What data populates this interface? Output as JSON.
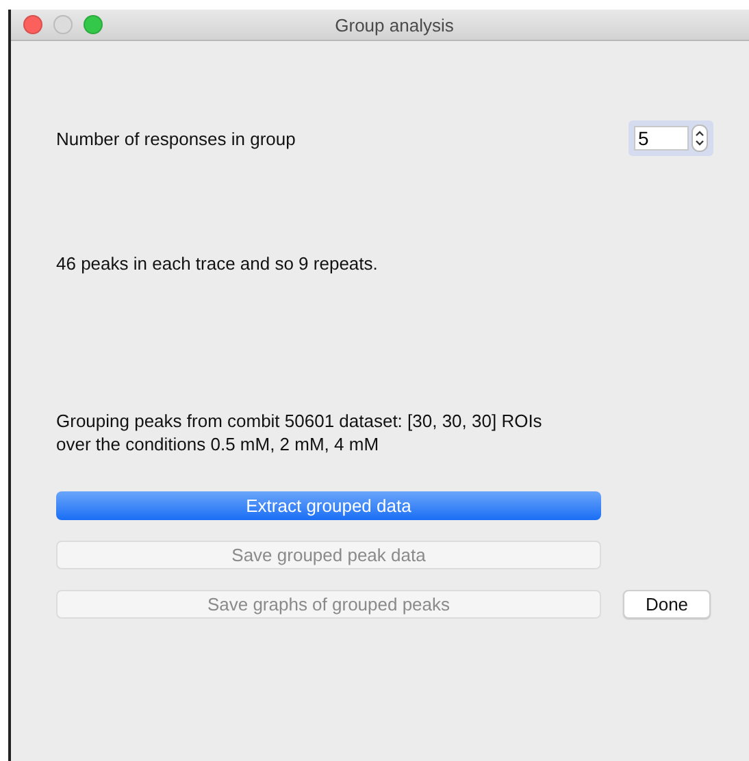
{
  "window": {
    "title": "Group analysis"
  },
  "responses": {
    "label": "Number of responses in group",
    "value": "5"
  },
  "peaks_info": "46 peaks in each trace and so 9 repeats.",
  "grouping_info": [
    "Grouping peaks from combit 50601 dataset: [30, 30, 30] ROIs",
    " over the conditions 0.5 mM, 2 mM, 4 mM"
  ],
  "buttons": [
    {
      "label": "Extract grouped data",
      "kind": "primary",
      "disabled": false
    },
    {
      "label": "Save grouped peak data",
      "kind": "normal",
      "disabled": true
    },
    {
      "label": "Save graphs of grouped peaks",
      "kind": "normal",
      "disabled": true
    }
  ],
  "done_button": {
    "label": "Done"
  }
}
